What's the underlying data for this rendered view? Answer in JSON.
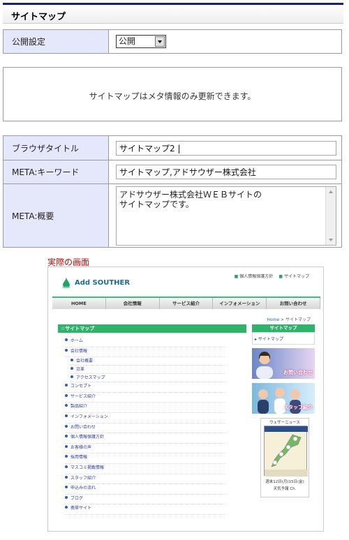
{
  "header": {
    "title": "サイトマップ"
  },
  "visibility": {
    "label": "公開設定",
    "selected": "公開"
  },
  "notice": {
    "text": "サイトマップはメタ情報のみ更新できます。"
  },
  "meta": {
    "browser_title_label": "ブラウザタイトル",
    "browser_title_value": "サイトマップ2 |",
    "keywords_label": "META:キーワード",
    "keywords_value": "サイトマップ,アドサウザー株式会社",
    "description_label": "META:概要",
    "description_lines": [
      "アドサウザー株式会社ＷＥＢサイトの",
      "サイトマップです。"
    ]
  },
  "preview": {
    "label": "実際の画面",
    "logo": "Add SOUTHER",
    "top_links": [
      "個人情報保護方針",
      "サイトマップ"
    ],
    "nav": [
      "HOME",
      "会社情報",
      "サービス紹介",
      "インフォメーション",
      "お問い合わせ"
    ],
    "breadcrumb": {
      "home": "Home",
      "current": "サイトマップ"
    },
    "main_heading": "サイトマップ",
    "items": [
      {
        "label": "ホーム",
        "sub": false
      },
      {
        "label": "会社情報",
        "sub": false
      },
      {
        "label": "会社概要",
        "sub": true
      },
      {
        "label": "沿革",
        "sub": true
      },
      {
        "label": "アクセスマップ",
        "sub": true
      },
      {
        "label": "コンセプト",
        "sub": false
      },
      {
        "label": "サービス紹介",
        "sub": false
      },
      {
        "label": "製品紹介",
        "sub": false
      },
      {
        "label": "インフォメーション",
        "sub": false
      },
      {
        "label": "お問い合わせ",
        "sub": false
      },
      {
        "label": "個人情報保護方針",
        "sub": false
      },
      {
        "label": "お客様の声",
        "sub": false
      },
      {
        "label": "採用情報",
        "sub": false
      },
      {
        "label": "マスコミ掲載情報",
        "sub": false
      },
      {
        "label": "スタッフ紹介",
        "sub": false
      },
      {
        "label": "申込みの流れ",
        "sub": false
      },
      {
        "label": "ブログ",
        "sub": false
      },
      {
        "label": "携帯サイト",
        "sub": false
      }
    ],
    "side_heading": "サイトマップ",
    "side_link": "サイトマップ",
    "banner_contact": "お問い合わせ",
    "banner_staff": "スタッフ紹介",
    "weather_title": "ウェザーニュース",
    "weather_date": "週末12日(月)15日(金)",
    "weather_footer": "天気予報 Ch."
  }
}
